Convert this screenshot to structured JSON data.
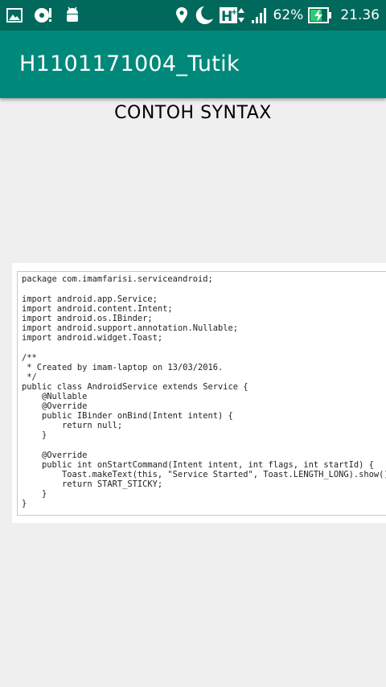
{
  "status_bar": {
    "left_icons": [
      "image-icon",
      "storage-alert-icon",
      "android-icon"
    ],
    "right_icons": [
      "location-icon",
      "moon-icon",
      "hplus-data-icon",
      "signal-icon",
      "battery-charging-icon"
    ],
    "battery": "62%",
    "time": "21.36"
  },
  "app_bar": {
    "title": "H1101171004_Tutik"
  },
  "main": {
    "heading": "CONTOH SYNTAX",
    "code_image_alt": "",
    "code_lines": [
      "package com.imamfarisi.serviceandroid;",
      "import android.app.Service;",
      "import android.content.Intent;",
      "import android.os.IBinder;",
      "import android.support.annotation.Nullable;",
      "import android.widget.Toast;",
      "/**",
      " * Created by imam-laptop on 13/03/2016.",
      " */",
      "public class AndroidService extends Service {",
      "    @Nullable",
      "    @Override",
      "    public IBinder onBind(Intent intent) {",
      "        return null;",
      "    }",
      "    @Override",
      "    public int onStartCommand(Intent intent, int flags, int startId) {",
      "        Toast.makeText(this, \"Service Started\", Toast.LENGTH_LONG).show();",
      "        return START_STICKY;",
      "    }",
      "}"
    ]
  },
  "colors": {
    "status_bar": "#00695c",
    "app_bar": "#00897b",
    "background": "#efefef"
  }
}
